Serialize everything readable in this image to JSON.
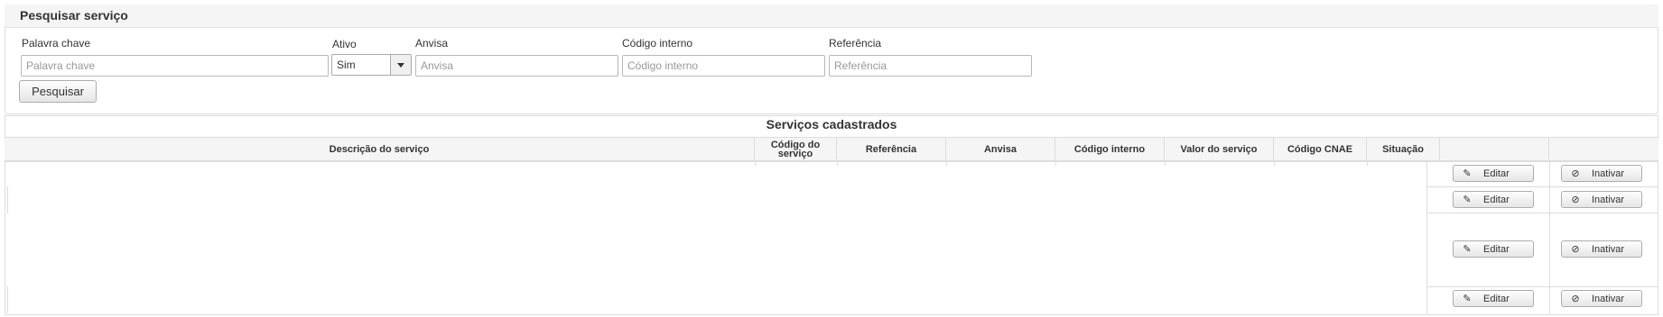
{
  "search_panel": {
    "title": "Pesquisar serviço",
    "fields": {
      "keyword": {
        "label": "Palavra chave",
        "placeholder": "Palavra chave",
        "value": ""
      },
      "active": {
        "label": "Ativo",
        "value": "Sim"
      },
      "anvisa": {
        "label": "Anvisa",
        "placeholder": "Anvisa",
        "value": ""
      },
      "internal_code": {
        "label": "Código interno",
        "placeholder": "Código interno",
        "value": ""
      },
      "reference": {
        "label": "Referência",
        "placeholder": "Referência",
        "value": ""
      }
    },
    "search_button": "Pesquisar"
  },
  "table": {
    "title": "Serviços cadastrados",
    "columns": [
      "Descrição do serviço",
      "Código do serviço",
      "Referência",
      "Anvisa",
      "Código interno",
      "Valor do serviço",
      "Código CNAE",
      "Situação",
      "",
      ""
    ],
    "rows": [
      {
        "edit_label": "Editar",
        "deactivate_label": "Inativar"
      },
      {
        "edit_label": "Editar",
        "deactivate_label": "Inativar"
      },
      {
        "edit_label": "Editar",
        "deactivate_label": "Inativar"
      },
      {
        "edit_label": "Editar",
        "deactivate_label": "Inativar"
      }
    ]
  },
  "icons": {
    "edit": "pencil-icon",
    "deactivate": "ban-icon"
  }
}
